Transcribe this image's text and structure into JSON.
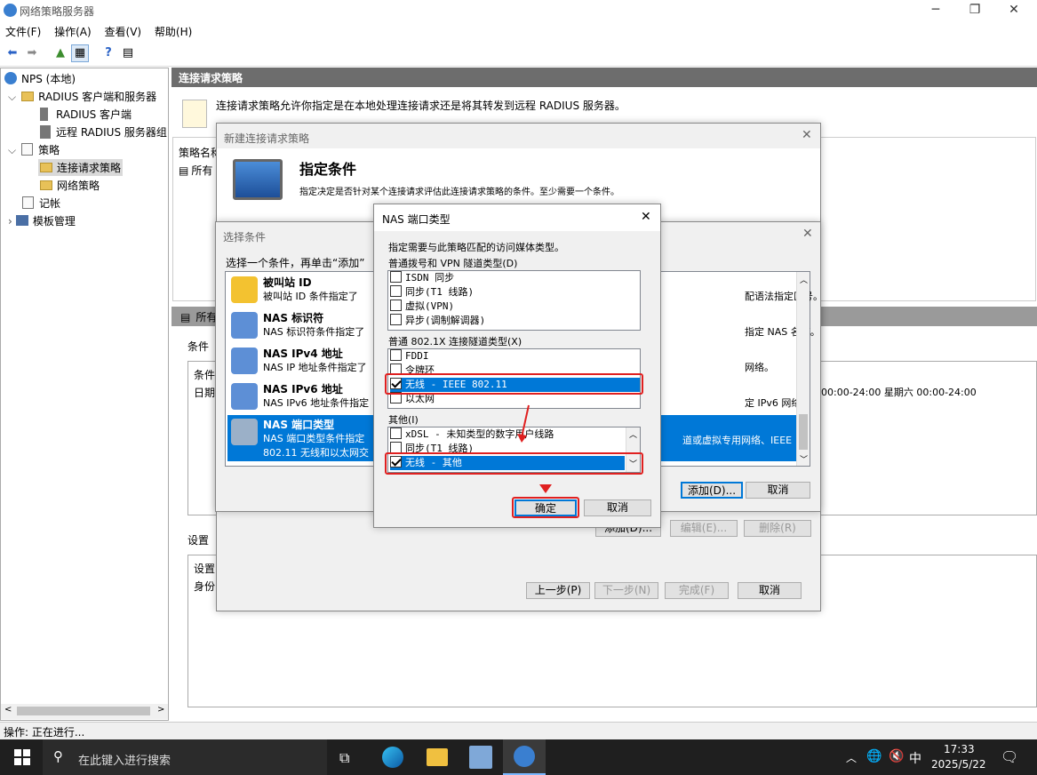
{
  "window": {
    "title": "网络策略服务器",
    "min": "─",
    "max": "❐",
    "close": "✕"
  },
  "menu": [
    "文件(F)",
    "操作(A)",
    "查看(V)",
    "帮助(H)"
  ],
  "tree": {
    "root": "NPS (本地)",
    "radius_group": "RADIUS 客户端和服务器",
    "radius_client": "RADIUS 客户端",
    "remote_group": "远程 RADIUS 服务器组",
    "policies": "策略",
    "crp": "连接请求策略",
    "np": "网络策略",
    "accounting": "记帐",
    "templates": "模板管理"
  },
  "main": {
    "header": "连接请求策略",
    "intro": "连接请求策略允许你指定是在本地处理连接请求还是将其转发到远程 RADIUS 服务器。",
    "policy_name_col": "策略名称",
    "policy_row": "所有",
    "section_header": "所有",
    "conditions_label": "条件",
    "cond_col": "条件",
    "cond_row": "日期",
    "time_text": "00:00-24:00 星期六 00:00-24:00",
    "settings_label": "设置",
    "settings_col": "设置",
    "settings_row": "身份"
  },
  "wizard": {
    "title": "新建连接请求策略",
    "heading": "指定条件",
    "desc": "指定决定是否针对某个连接请求评估此连接请求策略的条件。至少需要一个条件。",
    "add": "添加(D)...",
    "edit": "编辑(E)...",
    "remove": "删除(R)",
    "prev": "上一步(P)",
    "next": "下一步(N)",
    "finish": "完成(F)",
    "cancel": "取消"
  },
  "select_cond": {
    "title": "选择条件",
    "instruction": "选择一个条件，再单击“添加”",
    "items": [
      {
        "name": "被叫站 ID",
        "desc": "被叫站 ID 条件指定了",
        "tail": "配语法指定区号。"
      },
      {
        "name": "NAS 标识符",
        "desc": "NAS 标识符条件指定了",
        "tail": "指定 NAS 名称。"
      },
      {
        "name": "NAS IPv4 地址",
        "desc": "NAS IP 地址条件指定了",
        "tail": "网络。"
      },
      {
        "name": "NAS IPv6 地址",
        "desc": "NAS IPv6 地址条件指定",
        "tail": "定 IPv6 网络。"
      },
      {
        "name": "NAS 端口类型",
        "desc": "NAS 端口类型条件指定",
        "desc2": "802.11 无线和以太网交",
        "tail": "道或虚拟专用网络、IEEE"
      }
    ],
    "add": "添加(D)...",
    "cancel": "取消"
  },
  "nas_dialog": {
    "title": "NAS 端口类型",
    "close": "✕",
    "instruction": "指定需要与此策略匹配的访问媒体类型。",
    "group1_label": "普通拨号和 VPN 隧道类型(D)",
    "group1": [
      {
        "label": "ISDN 同步",
        "checked": false
      },
      {
        "label": "同步(T1 线路)",
        "checked": false
      },
      {
        "label": "虚拟(VPN)",
        "checked": false
      },
      {
        "label": "异步(调制解调器)",
        "checked": false
      }
    ],
    "group2_label": "普通 802.1X 连接隧道类型(X)",
    "group2": [
      {
        "label": "FDDI",
        "checked": false
      },
      {
        "label": "令牌环",
        "checked": false
      },
      {
        "label": "无线 - IEEE 802.11",
        "checked": true
      },
      {
        "label": "以太网",
        "checked": false
      }
    ],
    "group3_label": "其他(I)",
    "group3": [
      {
        "label": "xDSL - 未知类型的数字用户线路",
        "checked": false
      },
      {
        "label": "同步(T1 线路)",
        "checked": false
      },
      {
        "label": "无线 - 其他",
        "checked": true
      }
    ],
    "ok": "确定",
    "cancel": "取消"
  },
  "status": "操作: 正在进行...",
  "taskbar": {
    "search": "在此键入进行搜索",
    "time": "17:33",
    "date": "2025/5/22",
    "ime": "中"
  }
}
